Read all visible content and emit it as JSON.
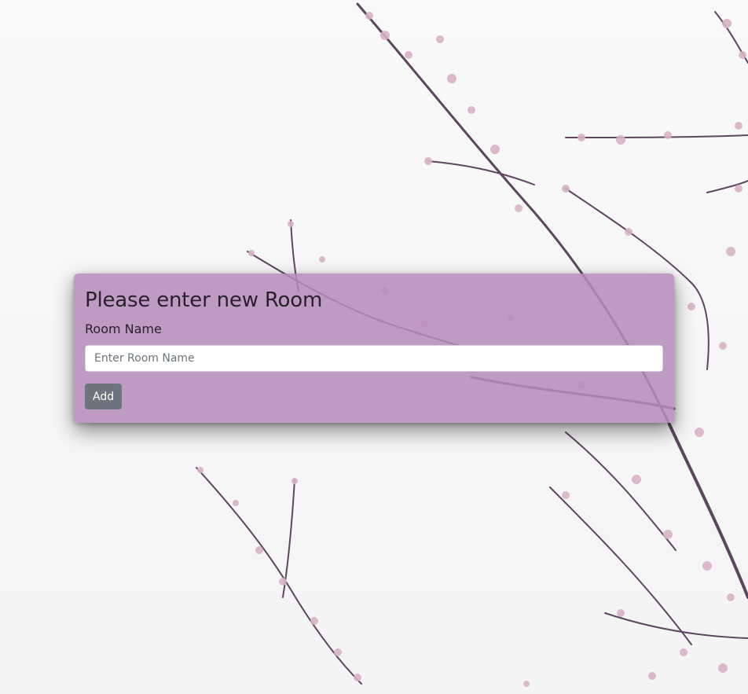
{
  "form": {
    "title": "Please enter new Room",
    "label": "Room Name",
    "placeholder": "Enter Room Name",
    "value": "",
    "submit_label": "Add"
  },
  "colors": {
    "card_background": "#b68cba",
    "button": "#6c757d",
    "blossom": "#d9b2c6",
    "branch": "#5a3f5c"
  }
}
